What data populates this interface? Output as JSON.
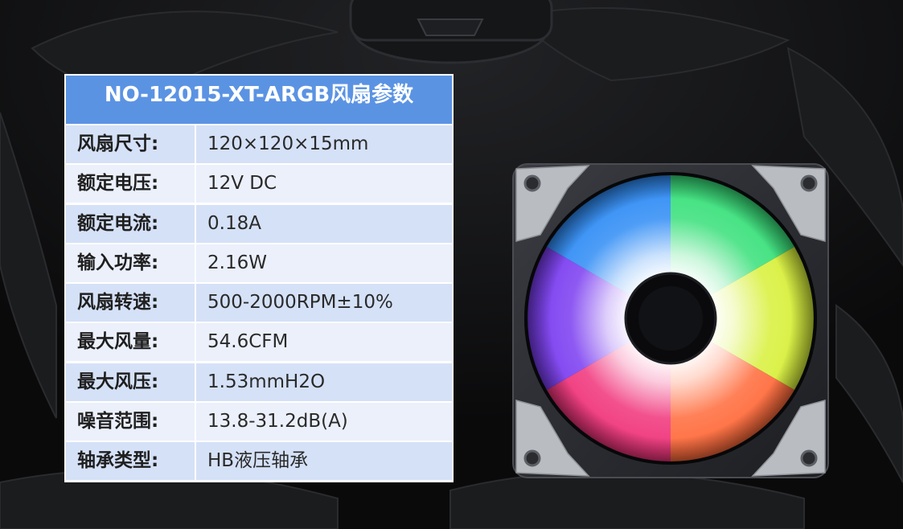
{
  "title": "NO-12015-XT-ARGB风扇参数",
  "specs": [
    {
      "label": "风扇尺寸:",
      "value": "120×120×15mm"
    },
    {
      "label": "额定电压:",
      "value": "12V DC"
    },
    {
      "label": "额定电流:",
      "value": "0.18A"
    },
    {
      "label": "输入功率:",
      "value": "2.16W"
    },
    {
      "label": "风扇转速:",
      "value": "500-2000RPM±10%"
    },
    {
      "label": "最大风量:",
      "value": "54.6CFM"
    },
    {
      "label": "最大风压:",
      "value": "1.53mmH2O"
    },
    {
      "label": "噪音范围:",
      "value": "13.8-31.2dB(A)"
    },
    {
      "label": "轴承类型:",
      "value": "HB液压轴承"
    }
  ],
  "colors": {
    "header": "#5b93e3",
    "row_dark": "#d5e1f7",
    "row_light": "#ebf0fb",
    "background": "#0b0b0c"
  }
}
